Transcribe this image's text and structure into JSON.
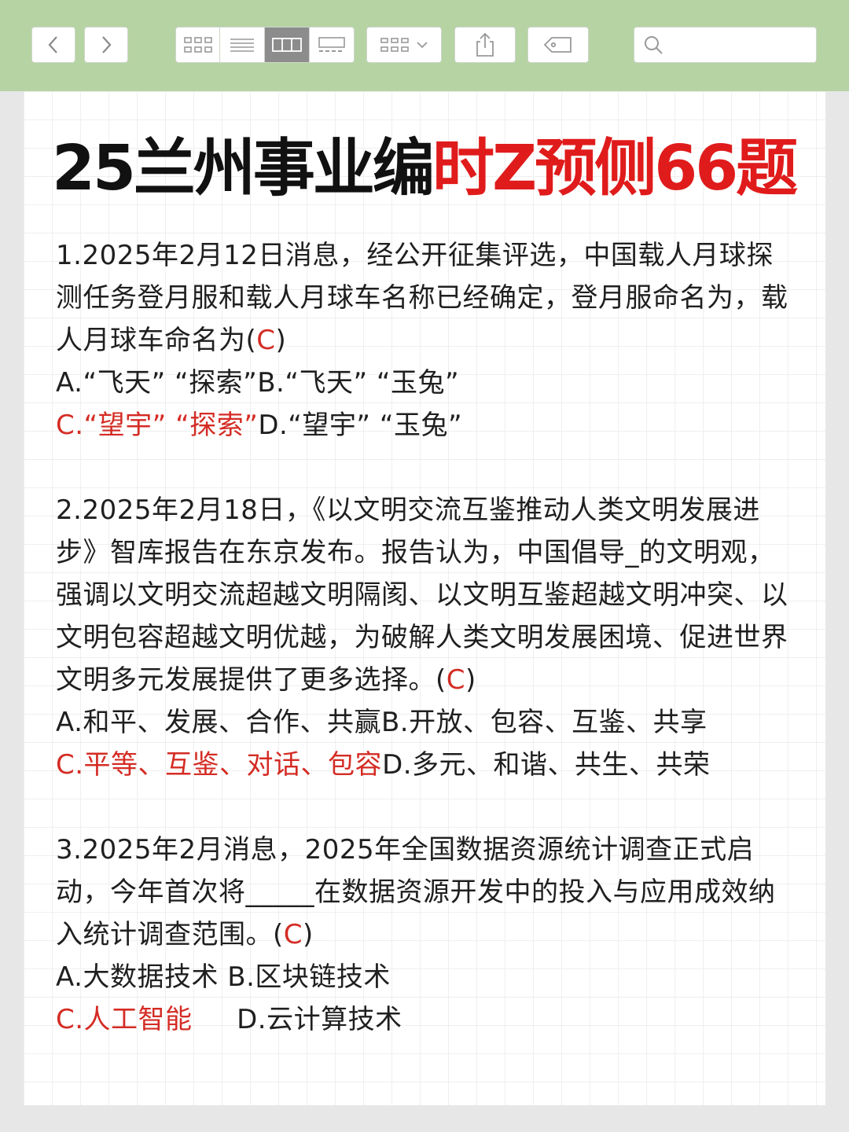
{
  "toolbar": {
    "back_icon": "chevron-left-icon",
    "forward_icon": "chevron-right-icon",
    "view_modes": [
      "grid-view-icon",
      "list-view-icon",
      "column-view-icon",
      "gallery-view-icon"
    ],
    "active_view": "column-view-icon",
    "search_placeholder": ""
  },
  "title": {
    "black": "25兰州事业编",
    "red": "时Z预侧66题"
  },
  "colors": {
    "accent_red": "#e01b1b",
    "toolbar_green": "#b6d3a3"
  },
  "questions": [
    {
      "stem": "1.2025年2月12日消息，经公开征集评选，中国载人月球探测任务登月服和载人月球车名称已经确定，登月服命名为，载人月球车命名为(",
      "answer": "C",
      "stem_end": ")",
      "opt_a": "A.“飞天” “探索”",
      "opt_b": "B.“飞天” “玉兔”",
      "opt_c": "C.“望宇” “探索”",
      "opt_d": "D.“望宇” “玉兔”"
    },
    {
      "stem": "2.2025年2月18日，《以文明交流互鉴推动人类文明发展进步》智库报告在东京发布。报告认为，中国倡导_的文明观，强调以文明交流超越文明隔阂、以文明互鉴超越文明冲突、以文明包容超越文明优越，为破解人类文明发展困境、促进世界文明多元发展提供了更多选择。(",
      "answer": "C",
      "stem_end": ")",
      "opt_a": "A.和平、发展、合作、共赢",
      "opt_b": "B.开放、包容、互鉴、共享",
      "opt_c": "C.平等、互鉴、对话、包容",
      "opt_d": "D.多元、和谐、共生、共荣"
    },
    {
      "stem": "3.2025年2月消息，2025年全国数据资源统计调查正式启动，今年首次将_____在数据资源开发中的投入与应用成效纳入统计调查范围。(",
      "answer": "C",
      "stem_end": ")",
      "opt_a": "A.大数据技术",
      "opt_b": "B.区块链技术",
      "opt_c": "C.人工智能",
      "opt_d": "D.云计算技术"
    }
  ]
}
